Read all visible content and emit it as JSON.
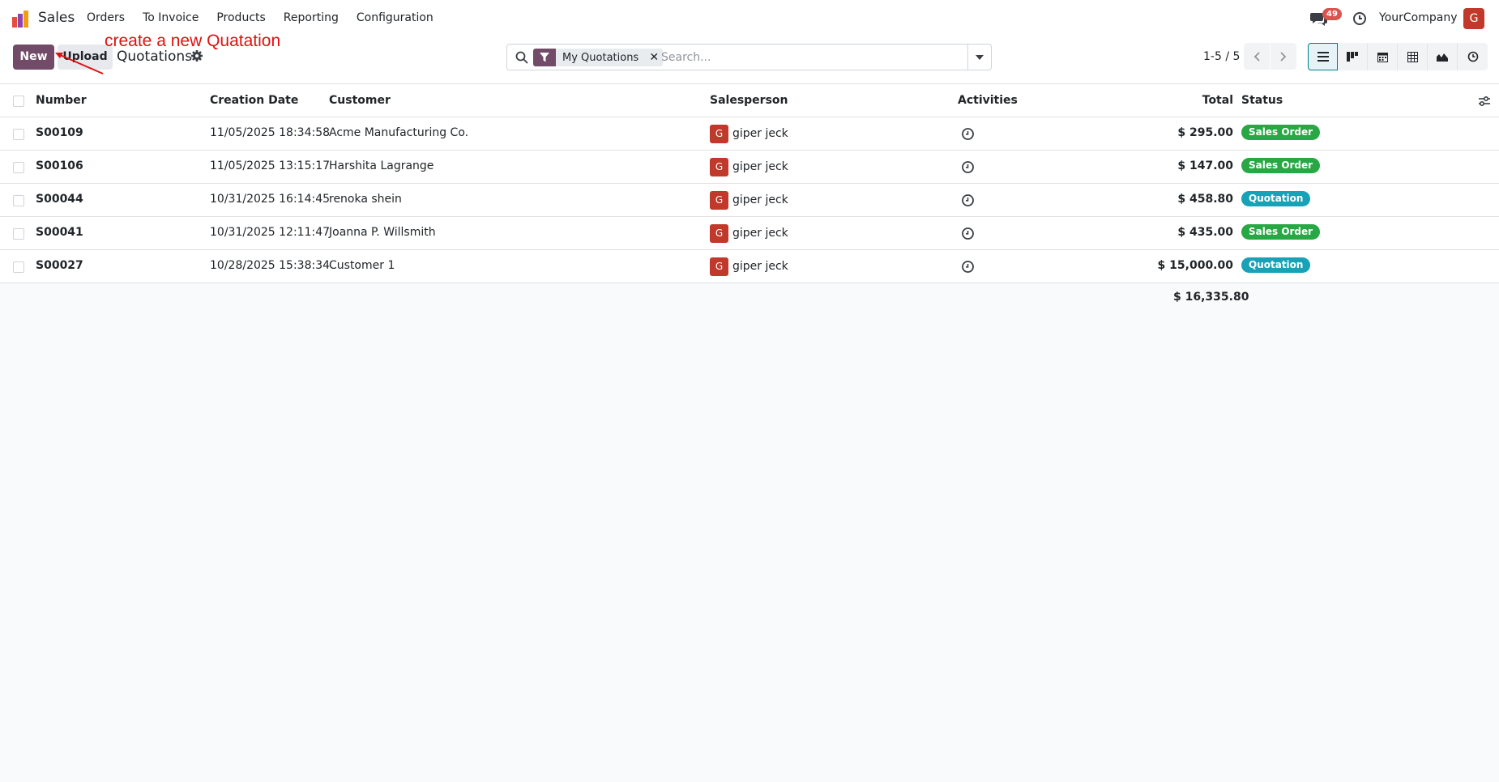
{
  "app": {
    "name": "Sales"
  },
  "nav": {
    "items": [
      "Orders",
      "To Invoice",
      "Products",
      "Reporting",
      "Configuration"
    ],
    "message_count": "49",
    "company": "YourCompany",
    "avatar_letter": "G"
  },
  "control": {
    "new_label": "New",
    "upload_label": "Upload",
    "title": "Quotations",
    "annotation": "create a new Quatation"
  },
  "search": {
    "facet": "My Quotations",
    "placeholder": "Search..."
  },
  "pager": {
    "text": "1-5 / 5"
  },
  "table": {
    "headers": {
      "number": "Number",
      "date": "Creation Date",
      "customer": "Customer",
      "salesperson": "Salesperson",
      "activities": "Activities",
      "total": "Total",
      "status": "Status"
    },
    "rows": [
      {
        "number": "S00109",
        "date": "11/05/2025 18:34:58",
        "customer": "Acme Manufacturing Co.",
        "sp_letter": "G",
        "salesperson": "giper jeck",
        "total": "$ 295.00",
        "status": "Sales Order"
      },
      {
        "number": "S00106",
        "date": "11/05/2025 13:15:17",
        "customer": "Harshita Lagrange",
        "sp_letter": "G",
        "salesperson": "giper jeck",
        "total": "$ 147.00",
        "status": "Sales Order"
      },
      {
        "number": "S00044",
        "date": "10/31/2025 16:14:45",
        "customer": "renoka shein",
        "sp_letter": "G",
        "salesperson": "giper jeck",
        "total": "$ 458.80",
        "status": "Quotation"
      },
      {
        "number": "S00041",
        "date": "10/31/2025 12:11:47",
        "customer": "Joanna P. Willsmith",
        "sp_letter": "G",
        "salesperson": "giper jeck",
        "total": "$ 435.00",
        "status": "Sales Order"
      },
      {
        "number": "S00027",
        "date": "10/28/2025 15:38:34",
        "customer": "Customer 1",
        "sp_letter": "G",
        "salesperson": "giper jeck",
        "total": "$ 15,000.00",
        "status": "Quotation"
      }
    ],
    "sum_total": "$ 16,335.80"
  },
  "colors": {
    "brand": "#714b67",
    "sales_order": "#28a745",
    "quotation": "#17a2b8",
    "annotation": "#e01010"
  }
}
